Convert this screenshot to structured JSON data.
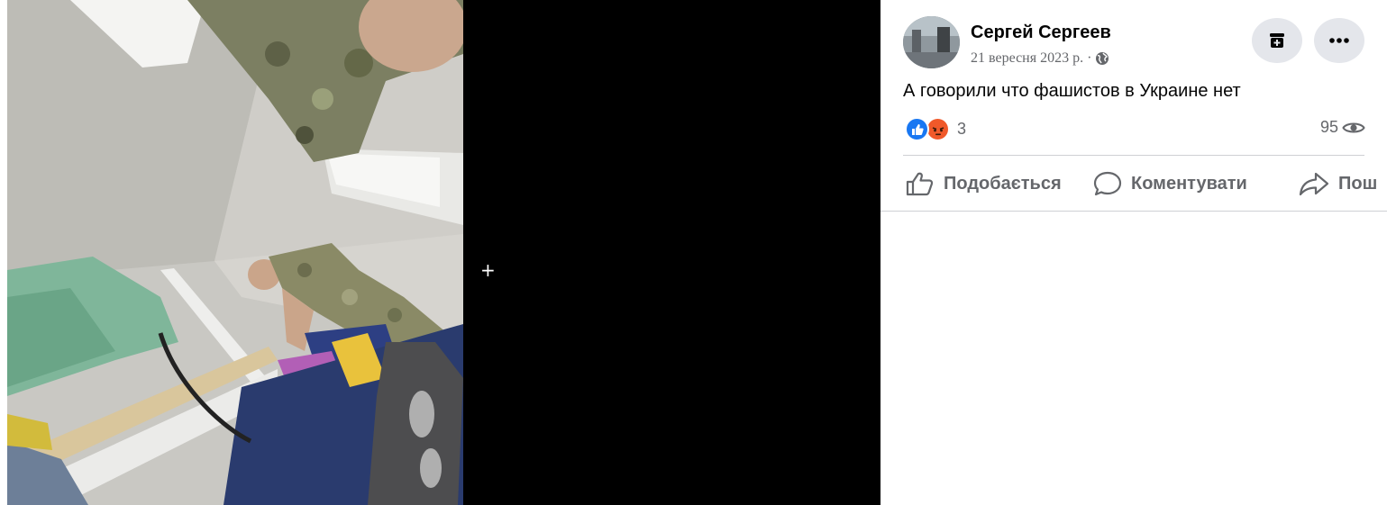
{
  "post": {
    "author": "Сергей Сергеев",
    "date": "21 вересня 2023 р. ·",
    "text": "А говорили что фашистов в Украине нет",
    "reaction_count": "3",
    "view_count": "95"
  },
  "actions": {
    "like_label": "Подобається",
    "comment_label": "Коментувати",
    "share_label": "Пош"
  },
  "icons": {
    "privacy": "globe-icon",
    "archive": "archive-icon",
    "more": "more-icon",
    "views": "eye-icon",
    "like_reaction": "like-reaction-icon",
    "angry_reaction": "angry-reaction-icon",
    "like_action": "thumbs-up-icon",
    "comment_action": "comment-icon",
    "share_action": "share-icon"
  },
  "colors": {
    "like_blue": "#1877f2",
    "angry_orange": "#f0592a",
    "secondary_text": "#65676b",
    "button_bg": "#e4e6eb"
  }
}
